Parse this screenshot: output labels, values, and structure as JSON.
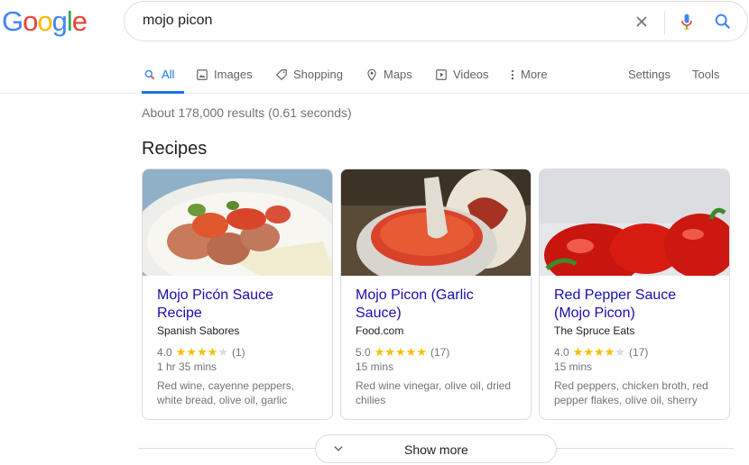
{
  "logo": {
    "letters": [
      "G",
      "o",
      "o",
      "g",
      "l",
      "e"
    ],
    "colors": [
      "#4285F4",
      "#EA4335",
      "#FBBC05",
      "#4285F4",
      "#34A853",
      "#EA4335"
    ]
  },
  "search": {
    "query": "mojo picon"
  },
  "tabs": [
    {
      "label": "All",
      "icon": "search-icon",
      "active": true
    },
    {
      "label": "Images",
      "icon": "image-icon"
    },
    {
      "label": "Shopping",
      "icon": "tag-icon"
    },
    {
      "label": "Maps",
      "icon": "map-pin-icon"
    },
    {
      "label": "Videos",
      "icon": "video-icon"
    },
    {
      "label": "More",
      "icon": "more-vert-icon"
    }
  ],
  "tools": {
    "settings": "Settings",
    "tools": "Tools"
  },
  "stats": "About 178,000 results (0.61 seconds)",
  "recipes": {
    "heading": "Recipes",
    "cards": [
      {
        "title": "Mojo Picón Sauce Recipe",
        "source": "Spanish Sabores",
        "rating": "4.0",
        "stars": 4,
        "reviews": "(1)",
        "time": "1 hr 35 mins",
        "ingredients": "Red wine, cayenne peppers, white bread, olive oil, garlic"
      },
      {
        "title": "Mojo Picon (Garlic Sauce)",
        "source": "Food.com",
        "rating": "5.0",
        "stars": 5,
        "reviews": "(17)",
        "time": "15 mins",
        "ingredients": "Red wine vinegar, olive oil, dried chilies"
      },
      {
        "title": "Red Pepper Sauce (Mojo Picon)",
        "source": "The Spruce Eats",
        "rating": "4.0",
        "stars": 4,
        "reviews": "(17)",
        "time": "15 mins",
        "ingredients": "Red peppers, chicken broth, red pepper flakes, olive oil, sherry"
      }
    ]
  },
  "show_more": "Show more",
  "colors": {
    "link": "#1a0dab",
    "accent": "#1a73e8",
    "star": "#fbbc04"
  }
}
